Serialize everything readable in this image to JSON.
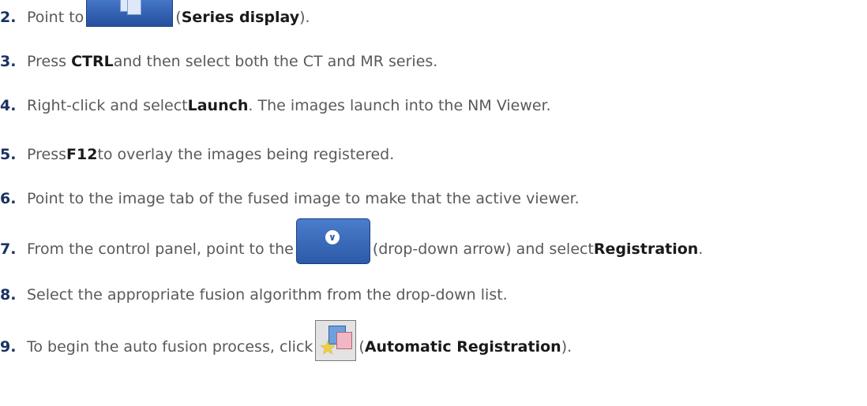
{
  "steps": [
    {
      "num": "2.",
      "pre": "Point to",
      "bold": "Series display",
      "post": ")."
    },
    {
      "num": "3.",
      "pre": "Press ",
      "bold": "CTRL",
      "post": " and then select both the CT and MR series."
    },
    {
      "num": "4.",
      "pre": "Right-click and select ",
      "bold": "Launch",
      "post": ". The images launch into the NM Viewer."
    },
    {
      "num": "5.",
      "pre": "Press ",
      "bold": "F12",
      "post": " to overlay the images being registered."
    },
    {
      "num": "6.",
      "text": "Point to the image tab of the fused image to make that the active viewer."
    },
    {
      "num": "7.",
      "pre": "From the control panel, point to the",
      "mid": "(drop-down arrow) and select ",
      "bold": "Registration",
      "post": "."
    },
    {
      "num": "8.",
      "text": "Select the appropriate fusion algorithm from the drop-down list."
    },
    {
      "num": "9.",
      "pre": "To begin the auto fusion process, click",
      "bold": "Automatic Registration",
      "post": ")."
    }
  ],
  "icons": {
    "series_display": "series-display-icon",
    "dropdown": "drop-down-arrow-icon",
    "auto_registration": "automatic-registration-icon"
  }
}
